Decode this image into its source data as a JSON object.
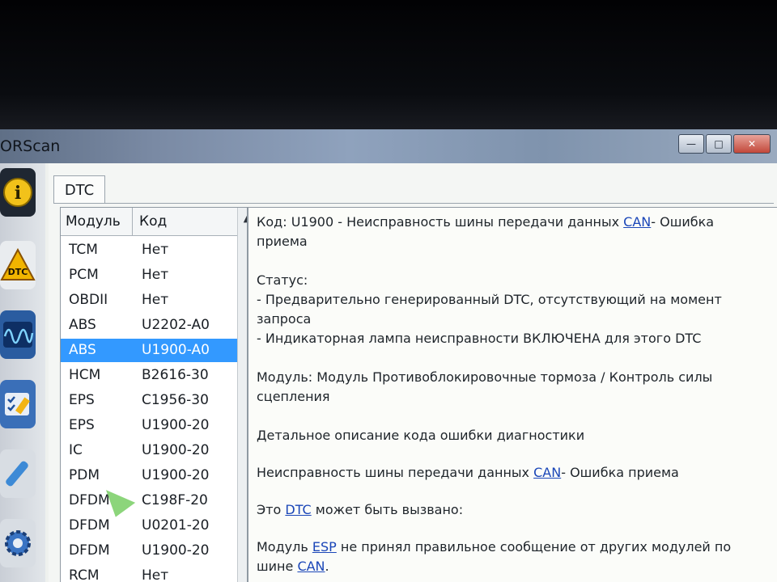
{
  "window": {
    "title": "ORScan",
    "controls": {
      "minimize": "—",
      "maximize": "□",
      "close": "✕"
    }
  },
  "sidebar": {
    "items": [
      {
        "icon": "info-icon",
        "label": "i"
      },
      {
        "icon": "dtc-icon",
        "label": "DTC"
      },
      {
        "icon": "oscilloscope-icon",
        "label": ""
      },
      {
        "icon": "checklist-icon",
        "label": ""
      },
      {
        "icon": "wrench-icon",
        "label": ""
      },
      {
        "icon": "gear-icon",
        "label": ""
      }
    ]
  },
  "tab": {
    "label": "DTC"
  },
  "list": {
    "headers": {
      "module": "Модуль",
      "code": "Код"
    },
    "rows": [
      {
        "module": "TCM",
        "code": "Нет"
      },
      {
        "module": "PCM",
        "code": "Нет"
      },
      {
        "module": "OBDII",
        "code": "Нет"
      },
      {
        "module": "ABS",
        "code": "U2202-A0"
      },
      {
        "module": "ABS",
        "code": "U1900-A0"
      },
      {
        "module": "HCM",
        "code": "B2616-30"
      },
      {
        "module": "EPS",
        "code": "C1956-30"
      },
      {
        "module": "EPS",
        "code": "U1900-20"
      },
      {
        "module": "IC",
        "code": "U1900-20"
      },
      {
        "module": "PDM",
        "code": "U1900-20"
      },
      {
        "module": "DFDM",
        "code": "C198F-20"
      },
      {
        "module": "DFDM",
        "code": "U0201-20"
      },
      {
        "module": "DFDM",
        "code": "U1900-20"
      },
      {
        "module": "RCM",
        "code": "Нет"
      }
    ],
    "selected_index": 4
  },
  "detail": {
    "code_line_1a": "Код: U1900 - Неисправность шины передачи данных ",
    "code_link": "CAN",
    "code_line_1b": "- Ошибка",
    "code_line_2": "приема",
    "status_title": "Статус:",
    "status_1": " - Предварительно генерированный DTC, отсутствующий на момент",
    "status_1b": "запроса",
    "status_2": " - Индикаторная лампа неисправности ВКЛЮЧЕНА для этого DTC",
    "module_1": "Модуль: Модуль Противоблокировочные тормоза / Контроль силы",
    "module_2": "сцепления",
    "desc_title": "Детальное описание кода ошибки диагностики",
    "fault_a": "Неисправность шины передачи данных ",
    "fault_link": "CAN",
    "fault_b": "- Ошибка приема",
    "cause_a": "Это ",
    "cause_link": "DTC",
    "cause_b": " может быть вызвано:",
    "module_err_a": "Модуль ",
    "module_err_link": "ESP",
    "module_err_b": " не принял правильное сообщение от других модулей по",
    "module_err_c": "шине ",
    "module_err_link2": "CAN",
    "module_err_d": "."
  }
}
